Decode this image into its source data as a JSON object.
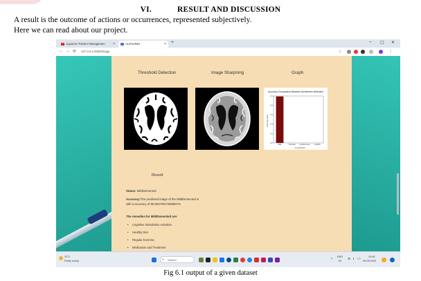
{
  "document": {
    "heading_number": "VI.",
    "heading_title": "RESULT AND DISCUSSION",
    "paragraph_1": "A result is the outcome of actions or occurrences, represented subjectively.",
    "paragraph_2": "Here we can read about our project.",
    "caption": "Fig 6.1 output of a given dataset"
  },
  "browser": {
    "tab1_title": "Liquorice Tracker Managemen",
    "tab2_title": "ALZHUNDI",
    "new_tab": "+",
    "url": "127.0.0.1:5000/image",
    "window_controls": [
      "–",
      "▢",
      "✕"
    ]
  },
  "app": {
    "sections": {
      "threshold_title": "Threshold Detection",
      "sharpening_title": "Image Sharpning",
      "graph_title": "Graph"
    },
    "graph": {
      "title": "Accuracy Comparison Between Alzheimers Detection",
      "ylabel": "accuracy level",
      "xlabel": "Comparision",
      "accent_color": "#7a0b0b"
    },
    "result": {
      "title": "Result",
      "status_label": "Status:",
      "status_value": "MildDemented",
      "accuracy_label": "Accuracy:",
      "accuracy_text": "The predicted image of the MildDemented is with a accuracy of 99.08279617658687%",
      "remedies_heading": "The remedies for MildDemented are:",
      "remedies": [
        "Cognitive Stimulation Activities",
        "Healthy Diet",
        "Regular Exercise",
        "Medication and Treatment"
      ]
    }
  },
  "taskbar": {
    "weather_temp": "31°C",
    "weather_text": "Partly sunny",
    "search_placeholder": "Search",
    "language": "ENG",
    "region": "IN",
    "time": "12:46",
    "date": "09-05-2024"
  },
  "chart_data": {
    "type": "bar",
    "title": "Accuracy Comparison Between Alzheimers Detection",
    "xlabel": "Comparision",
    "ylabel": "accuracy level",
    "categories": [
      "Mild",
      "Moderate",
      "NonDemented",
      "VeryMild"
    ],
    "values": [
      0.99,
      0,
      0,
      0
    ],
    "ylim": [
      0,
      1.0
    ],
    "yticks": [
      "1.0",
      "0.8",
      "0.6",
      "0.4",
      "0.2",
      "0.0"
    ]
  }
}
